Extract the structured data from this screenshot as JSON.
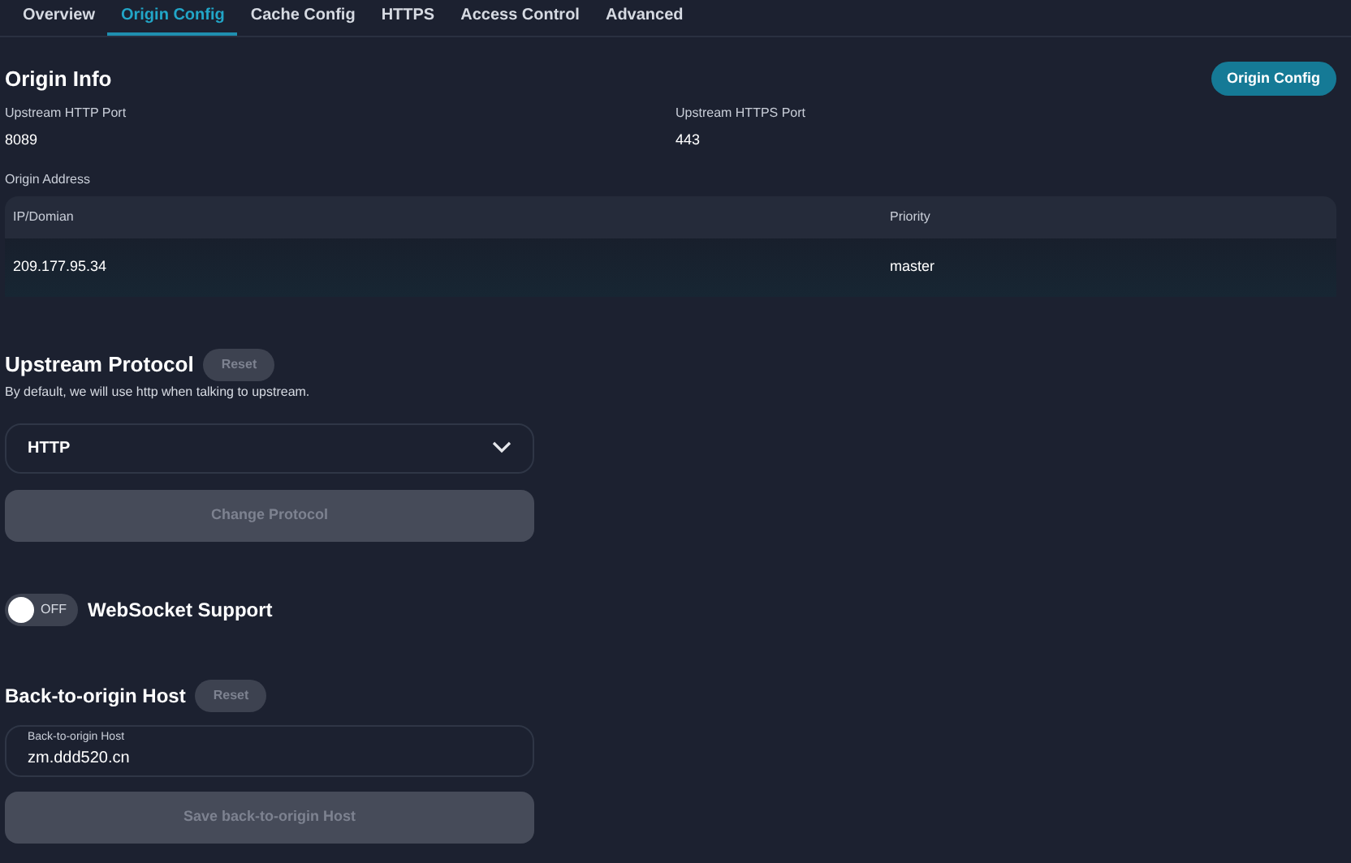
{
  "tabs": [
    {
      "label": "Overview",
      "selected": false
    },
    {
      "label": "Origin Config",
      "selected": true
    },
    {
      "label": "Cache Config",
      "selected": false
    },
    {
      "label": "HTTPS",
      "selected": false
    },
    {
      "label": "Access Control",
      "selected": false
    },
    {
      "label": "Advanced",
      "selected": false
    }
  ],
  "origin_info": {
    "title": "Origin Info",
    "button": "Origin Config",
    "fields": [
      {
        "label": "Upstream HTTP Port",
        "value": "8089"
      },
      {
        "label": "Upstream HTTPS Port",
        "value": "443"
      }
    ],
    "address_label": "Origin Address",
    "table": {
      "columns": [
        "IP/Domian",
        "Priority"
      ],
      "rows": [
        [
          "209.177.95.34",
          "master"
        ]
      ]
    }
  },
  "upstream_protocol": {
    "title": "Upstream Protocol",
    "reset": {
      "label": "Reset",
      "disabled": true
    },
    "description": "By default, we will use http when talking to upstream.",
    "select": {
      "value": "HTTP"
    },
    "button": {
      "label": "Change Protocol",
      "disabled": true
    }
  },
  "websocket": {
    "label": "WebSocket Support",
    "on": false,
    "toggle_text": "OFF"
  },
  "back_to_origin_host": {
    "title": "Back-to-origin Host",
    "reset": {
      "label": "Reset",
      "disabled": true
    },
    "field": {
      "label": "Back-to-origin Host",
      "value": "zm.ddd520.cn"
    },
    "button": {
      "label": "Save back-to-origin Host",
      "disabled": true
    }
  }
}
